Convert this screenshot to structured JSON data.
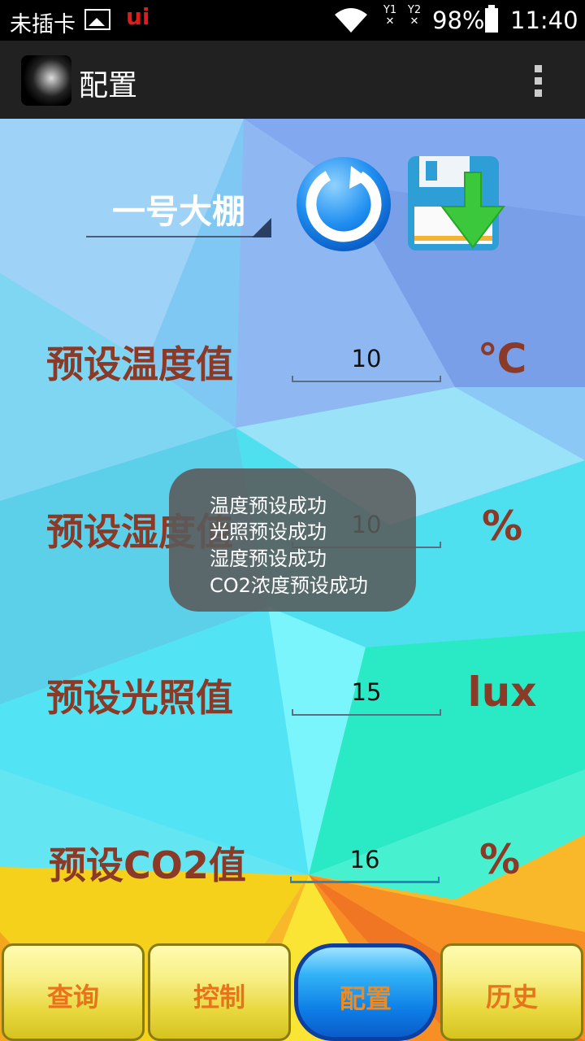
{
  "status_bar": {
    "sim_text": "未插卡",
    "app_badge": "ui",
    "sig1": "Y1",
    "sig2": "Y2",
    "battery": "98%",
    "time": "11:40"
  },
  "action_bar": {
    "title": "配置"
  },
  "greenhouse_select": {
    "value": "一号大棚"
  },
  "rows": [
    {
      "label": "预设温度值",
      "value": "10",
      "unit": "℃"
    },
    {
      "label": "预设湿度值",
      "value": "10",
      "unit": "%"
    },
    {
      "label": "预设光照值",
      "value": "15",
      "unit": "lux"
    },
    {
      "label": "预设CO2值",
      "value": "16",
      "unit": "%"
    }
  ],
  "toast": {
    "lines": [
      "温度预设成功",
      "光照预设成功",
      "湿度预设成功",
      "CO2浓度预设成功"
    ]
  },
  "nav": {
    "items": [
      "查询",
      "控制",
      "配置",
      "历史"
    ],
    "active": "配置"
  },
  "colors": {
    "label": "#8a3a27",
    "toast_bg": "#5a5a5a",
    "nav_text": "#e8731a",
    "active_nav": "#0d7ee6"
  }
}
